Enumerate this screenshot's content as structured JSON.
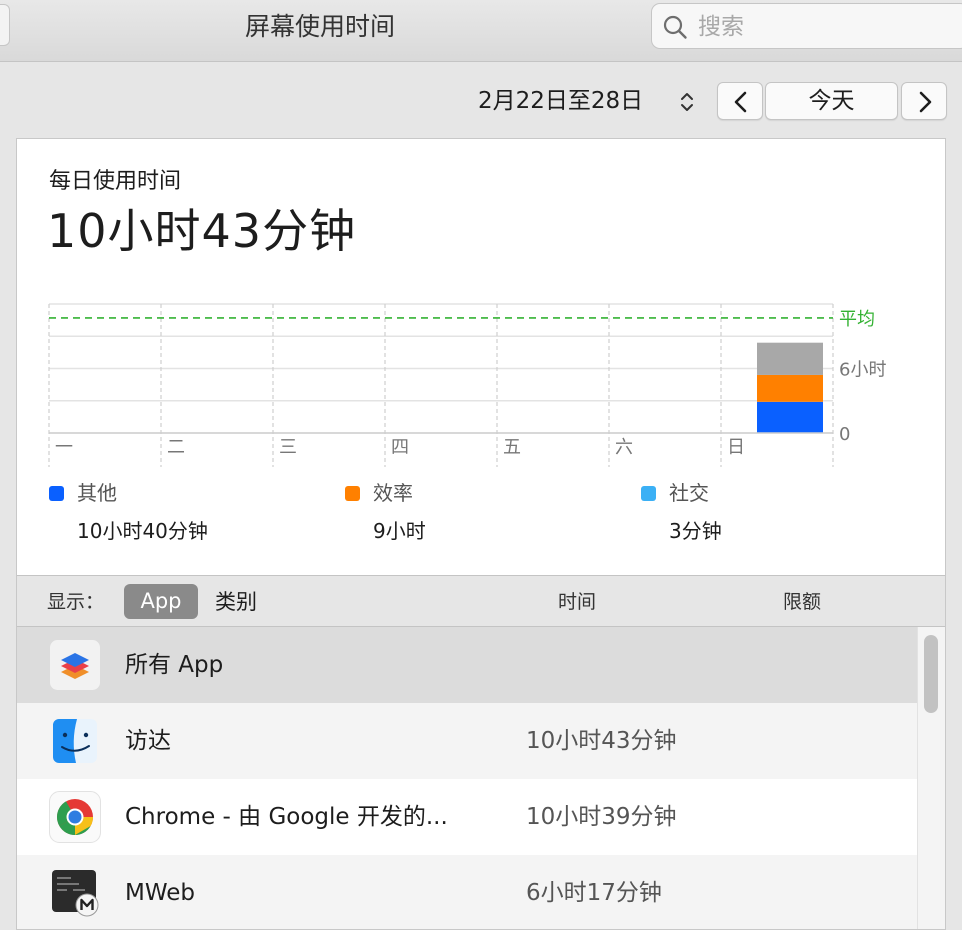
{
  "window": {
    "title": "屏幕使用时间"
  },
  "search": {
    "placeholder": "搜索"
  },
  "date_nav": {
    "range": "2月22日至28日",
    "today_label": "今天"
  },
  "summary": {
    "label": "每日使用时间",
    "value": "10小时43分钟"
  },
  "chart_data": {
    "type": "bar",
    "stacked": true,
    "categories": [
      "一",
      "二",
      "三",
      "四",
      "五",
      "六",
      "日"
    ],
    "series": [
      {
        "name": "其他",
        "color": "#0a60ff",
        "values": [
          0,
          0,
          0,
          0,
          0,
          0,
          2.9
        ]
      },
      {
        "name": "效率",
        "color": "#ff8000",
        "values": [
          0,
          0,
          0,
          0,
          0,
          0,
          2.5
        ]
      },
      {
        "name": "",
        "color": "#a8a8a8",
        "values": [
          0,
          0,
          0,
          0,
          0,
          0,
          3.0
        ]
      }
    ],
    "y_ticks": [
      {
        "value": 0,
        "label": "0"
      },
      {
        "value": 6,
        "label": "6小时"
      }
    ],
    "average": {
      "label": "平均",
      "value": 10.7,
      "color": "#34b233"
    },
    "ylim": [
      0,
      12
    ]
  },
  "legend": [
    {
      "name": "其他",
      "time": "10小时40分钟",
      "color": "#0a60ff"
    },
    {
      "name": "效率",
      "time": "9小时",
      "color": "#ff8000"
    },
    {
      "name": "社交",
      "time": "3分钟",
      "color": "#3bb0f5"
    }
  ],
  "toolbar": {
    "show_label": "显示：",
    "seg_app": "App",
    "seg_category": "类别",
    "col_time": "时间",
    "col_limit": "限额"
  },
  "apps": [
    {
      "name": "所有 App",
      "time": "",
      "icon": "all-apps-icon"
    },
    {
      "name": "访达",
      "time": "10小时43分钟",
      "icon": "finder-icon"
    },
    {
      "name": "Chrome - 由 Google 开发的...",
      "time": "10小时39分钟",
      "icon": "chrome-icon"
    },
    {
      "name": "MWeb",
      "time": "6小时17分钟",
      "icon": "mweb-icon"
    }
  ]
}
